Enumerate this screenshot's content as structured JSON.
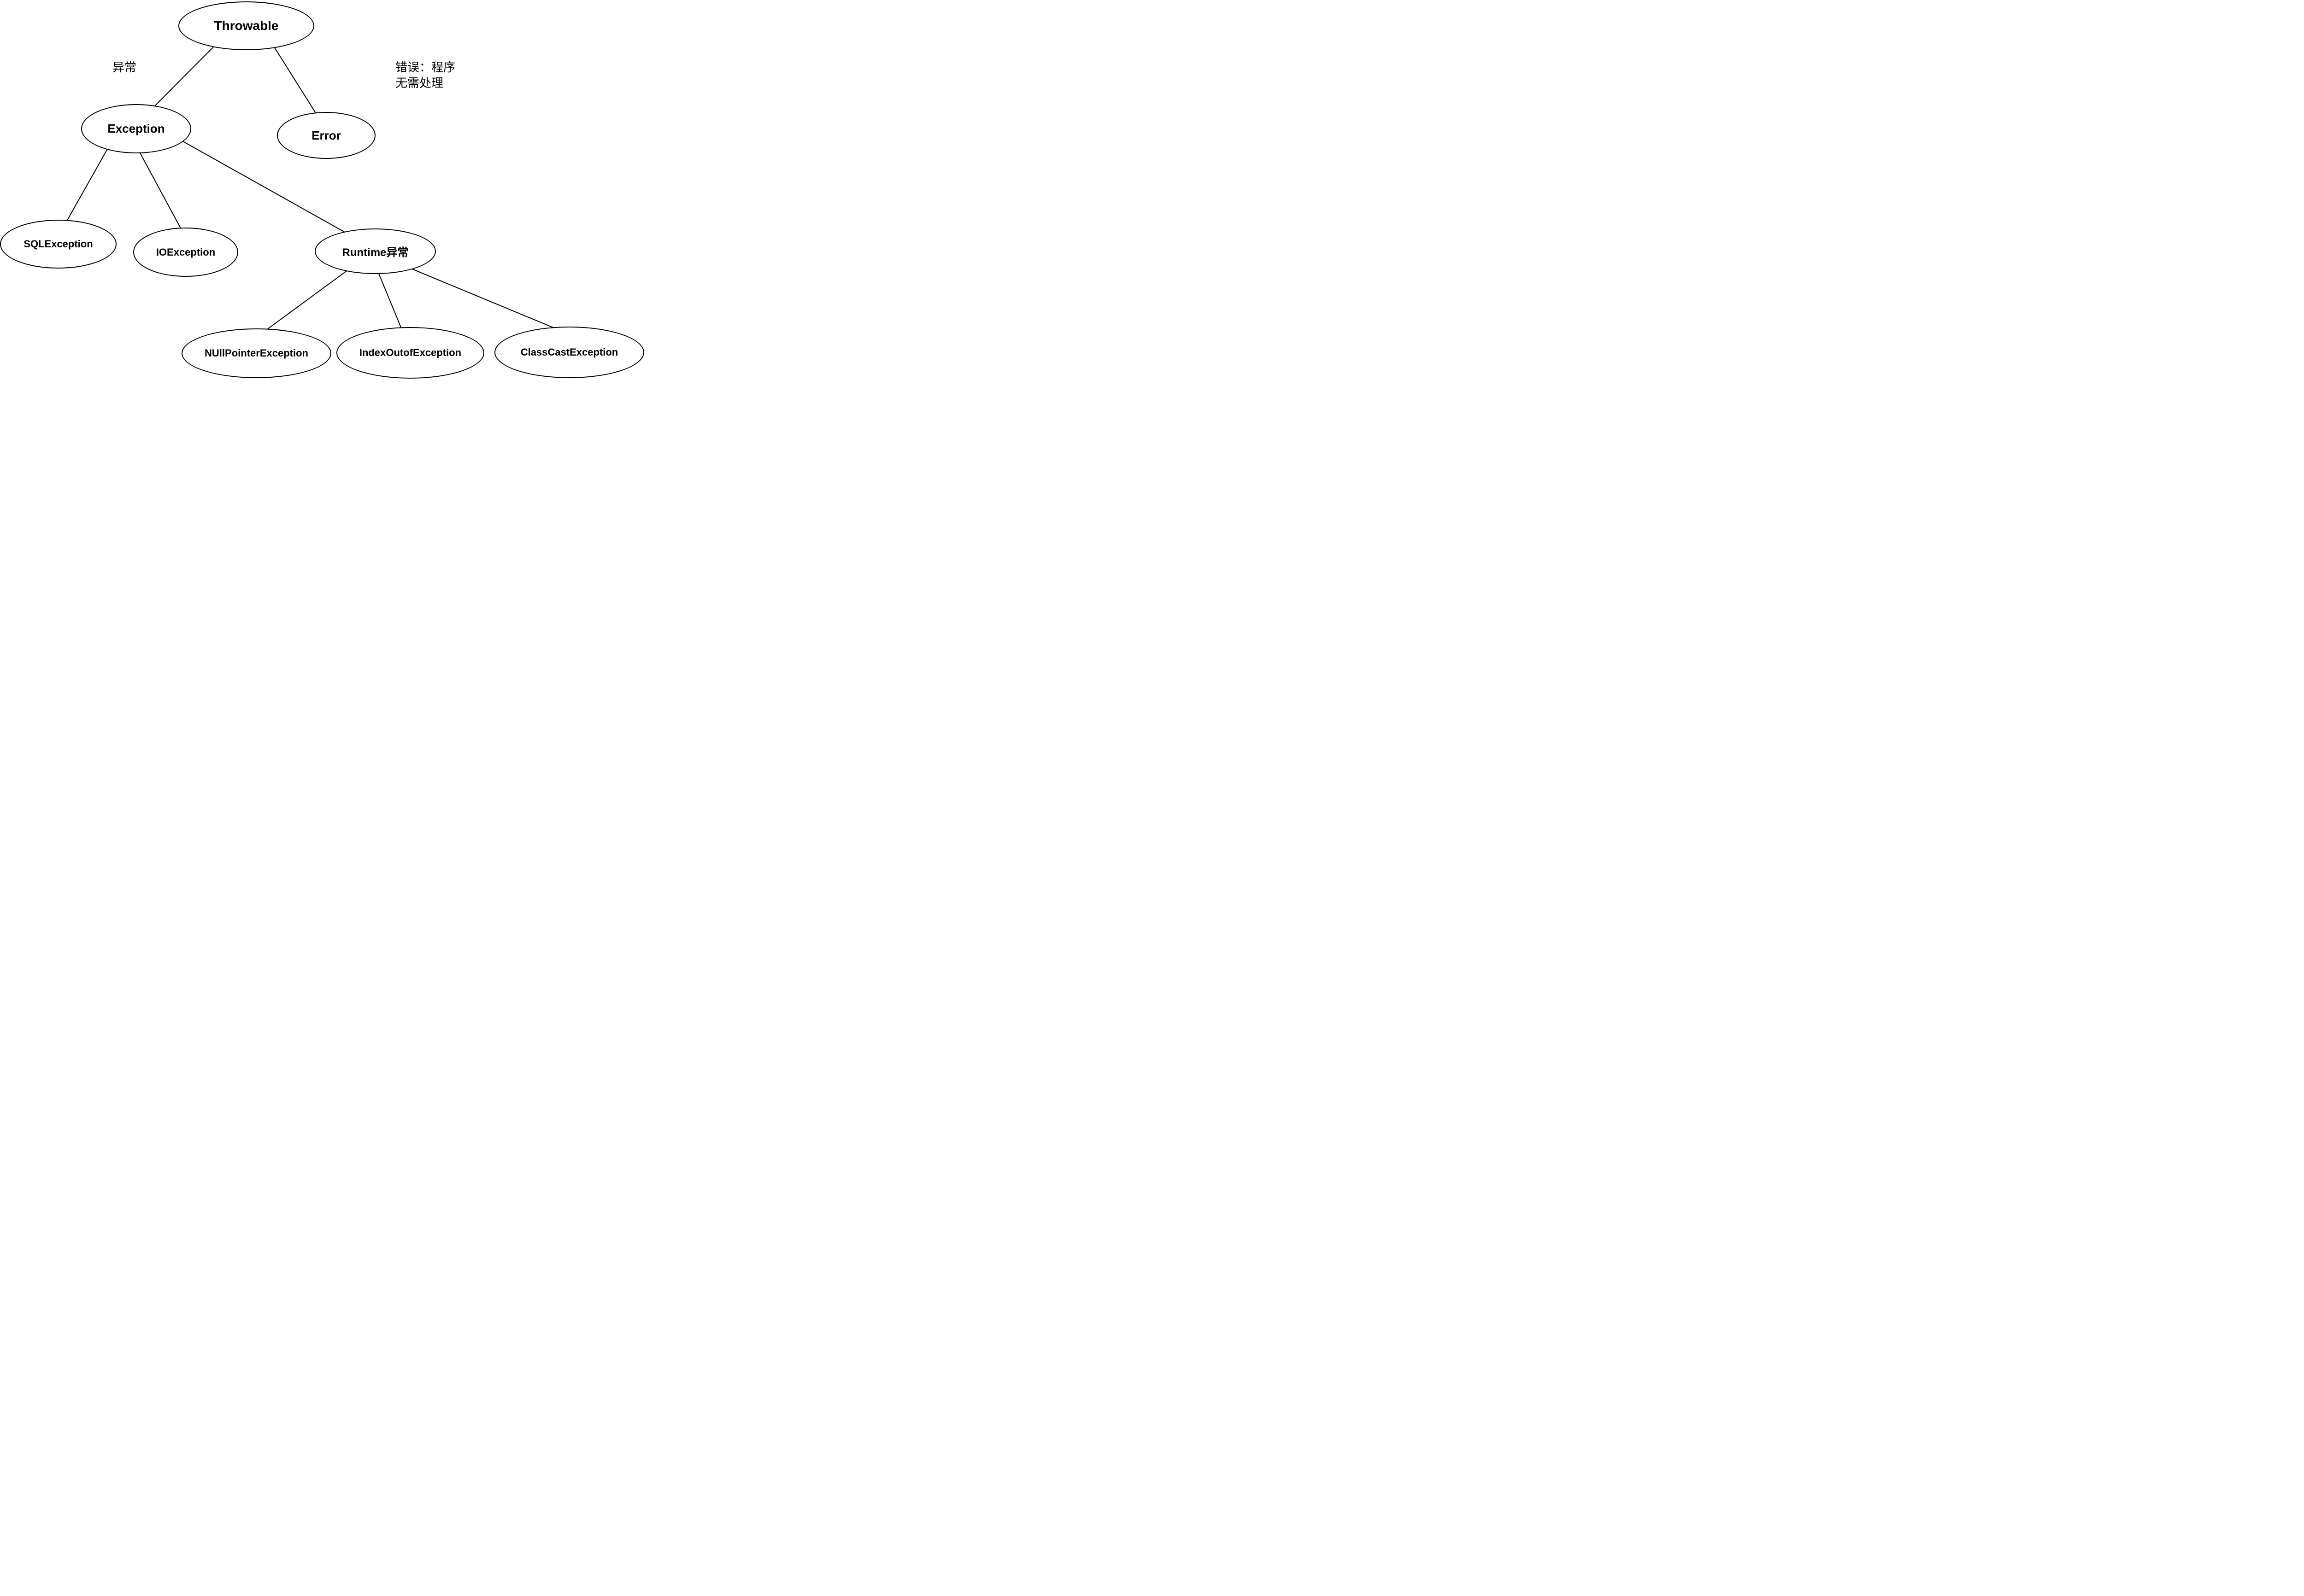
{
  "nodes": {
    "throwable": {
      "label": "Throwable"
    },
    "exception": {
      "label": "Exception"
    },
    "error": {
      "label": "Error"
    },
    "sqlexception": {
      "label": "SQLException"
    },
    "ioexception": {
      "label": "IOException"
    },
    "runtime": {
      "label": "Runtime异常"
    },
    "nullpointer": {
      "label": "NUllPointerException"
    },
    "indexoutof": {
      "label": "IndexOutofException"
    },
    "classcast": {
      "label": "ClassCastException"
    }
  },
  "annotations": {
    "exception_label": "异常",
    "error_label_line1": "错误：程序",
    "error_label_line2": "无需处理"
  }
}
